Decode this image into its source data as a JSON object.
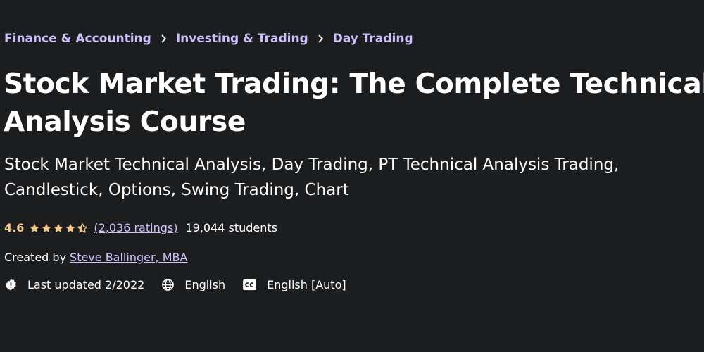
{
  "breadcrumb": {
    "items": [
      "Finance & Accounting",
      "Investing & Trading",
      "Day Trading"
    ]
  },
  "course": {
    "title": "Stock Market Trading: The Complete Technical Analysis Course",
    "subtitle": "Stock Market Technical Analysis, Day Trading, PT Technical Analysis Trading, Candlestick, Options, Swing Trading, Chart",
    "rating": "4.6",
    "rating_value": 4.6,
    "ratings_count": "(2,036 ratings)",
    "students": "19,044 students",
    "created_by_label": "Created by",
    "instructor": "Steve Ballinger, MBA",
    "last_updated": "Last updated 2/2022",
    "language": "English",
    "captions": "English [Auto]"
  },
  "icons": {
    "separator": "chevron-right-icon",
    "star": "star-icon",
    "updated": "alert-badge-icon",
    "language": "globe-icon",
    "captions": "closed-captions-icon"
  },
  "colors": {
    "background": "#1c1d1f",
    "link": "#cec0fc",
    "rating": "#f3ca8c",
    "text": "#ffffff"
  }
}
